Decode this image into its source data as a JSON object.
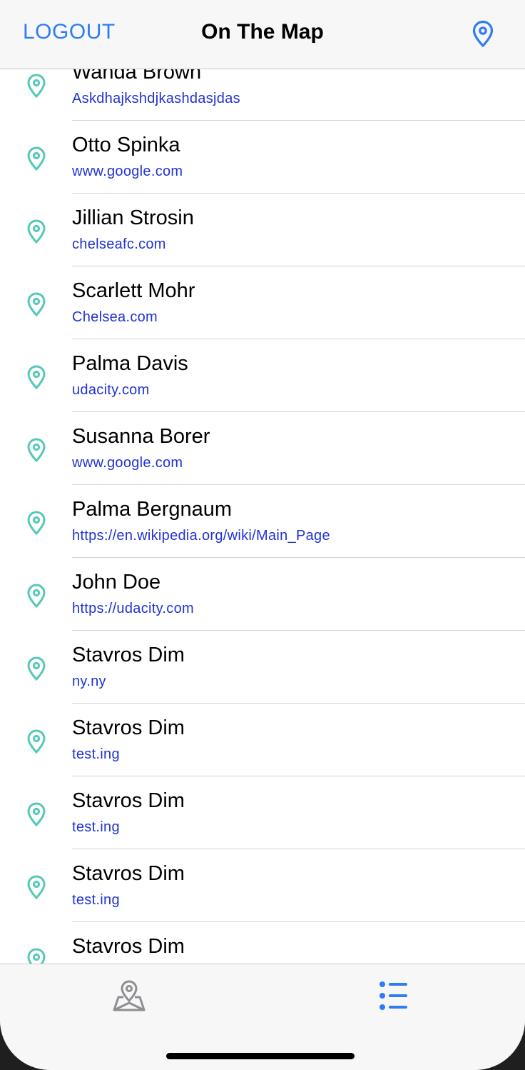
{
  "navbar": {
    "left_label": "LOGOUT",
    "title": "On The Map",
    "right_icon": "location-pin-icon"
  },
  "colors": {
    "accent": "#2f7cf6",
    "pin": "#56c8b8",
    "link": "#1f33d6"
  },
  "students": [
    {
      "name": "Wanda Brown",
      "url": "Askdhajkshdjkashdasjdas"
    },
    {
      "name": "Otto Spinka",
      "url": "www.google.com"
    },
    {
      "name": "Jillian Strosin",
      "url": "chelseafc.com"
    },
    {
      "name": "Scarlett Mohr",
      "url": "Chelsea.com"
    },
    {
      "name": "Palma Davis",
      "url": "udacity.com"
    },
    {
      "name": "Susanna Borer",
      "url": "www.google.com"
    },
    {
      "name": "Palma Bergnaum",
      "url": "https://en.wikipedia.org/wiki/Main_Page"
    },
    {
      "name": "John Doe",
      "url": "https://udacity.com"
    },
    {
      "name": "Stavros Dim",
      "url": "ny.ny"
    },
    {
      "name": "Stavros Dim",
      "url": "test.ing"
    },
    {
      "name": "Stavros Dim",
      "url": "test.ing"
    },
    {
      "name": "Stavros Dim",
      "url": "test.ing"
    },
    {
      "name": "Stavros Dim",
      "url": ""
    }
  ],
  "tabbar": {
    "tabs": [
      {
        "icon": "map-tab-icon",
        "selected": false
      },
      {
        "icon": "list-tab-icon",
        "selected": true
      }
    ]
  }
}
